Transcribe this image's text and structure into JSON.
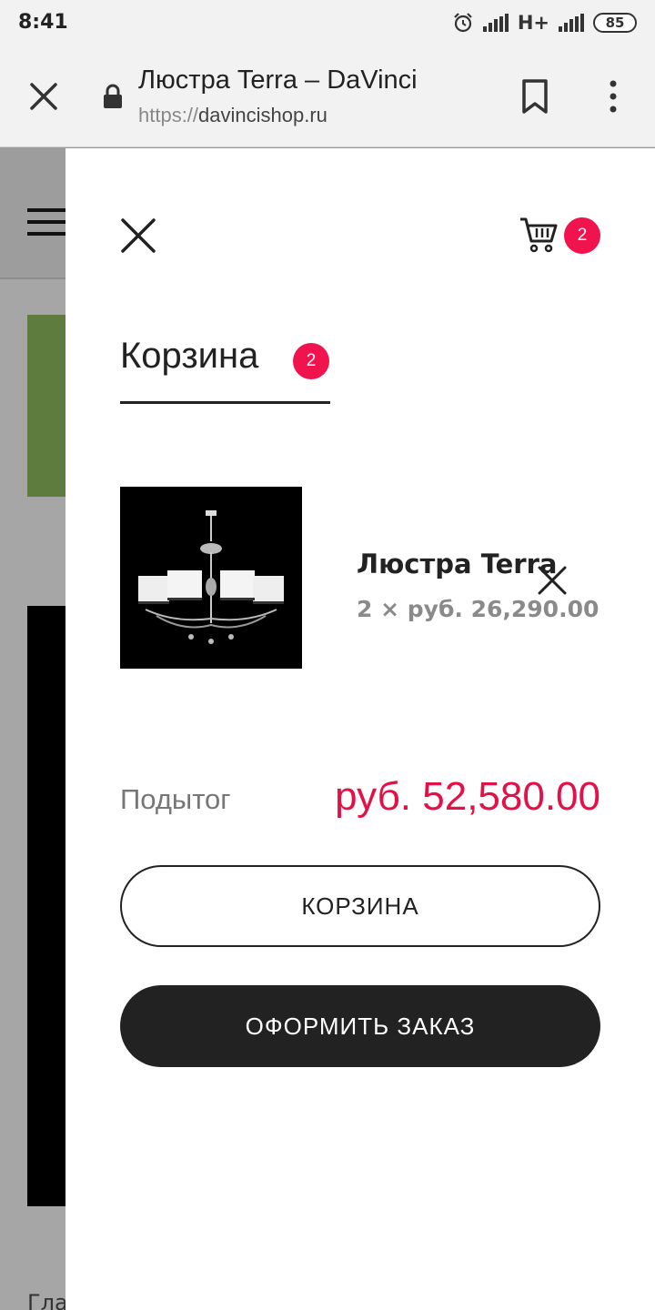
{
  "status_bar": {
    "time": "8:41",
    "network": "H+",
    "battery": "85"
  },
  "browser": {
    "page_title": "Люстра Terra – DaVinci",
    "url_protocol": "https://",
    "url_domain": "davincishop.ru"
  },
  "background_page": {
    "bottom_text": "Гла"
  },
  "drawer": {
    "cart_count": "2",
    "title": "Корзина",
    "title_count": "2",
    "items": [
      {
        "name": "Люстра Terra",
        "quantity_price": "2 × руб. 26,290.00"
      }
    ],
    "subtotal_label": "Подытог",
    "subtotal_value": "руб. 52,580.00",
    "cart_button": "КОРЗИНА",
    "checkout_button": "ОФОРМИТЬ ЗАКАЗ"
  },
  "colors": {
    "accent": "#f0134d",
    "price": "#e21148",
    "dark": "#222222"
  }
}
